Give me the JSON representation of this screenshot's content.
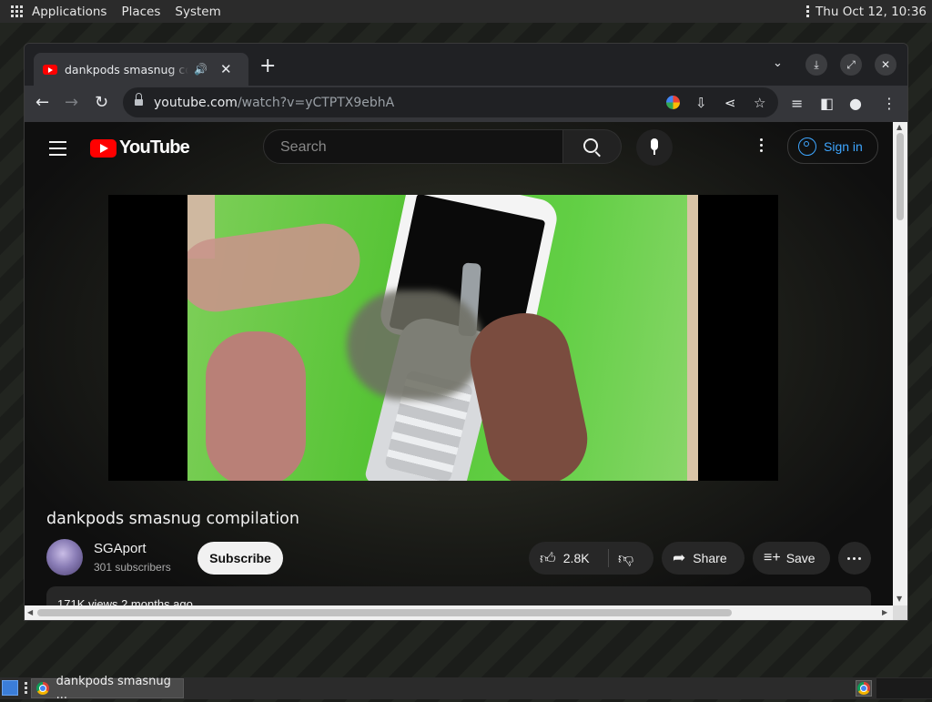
{
  "top_panel": {
    "menus": [
      "Applications",
      "Places",
      "System"
    ],
    "clock": "Thu Oct 12, 10:36"
  },
  "browser": {
    "tab_title": "dankpods smasnug compilation - YouTube",
    "url_host": "youtube.com",
    "url_path": "/watch?v=yCTPTX9ebhA"
  },
  "youtube": {
    "logo_text": "YouTube",
    "search_placeholder": "Search",
    "signin_label": "Sign in",
    "video": {
      "title": "dankpods smasnug compilation",
      "channel": "SGAport",
      "subscribers": "301 subscribers",
      "subscribe_label": "Subscribe",
      "likes": "2.8K",
      "share_label": "Share",
      "save_label": "Save",
      "description_preview": "171K views  2 months ago"
    }
  },
  "taskbar": {
    "task_label": "dankpods smasnug ..."
  },
  "colors": {
    "youtube_red": "#ff0000",
    "link_blue": "#3ea6ff",
    "page_bg": "#0f0f0f"
  }
}
